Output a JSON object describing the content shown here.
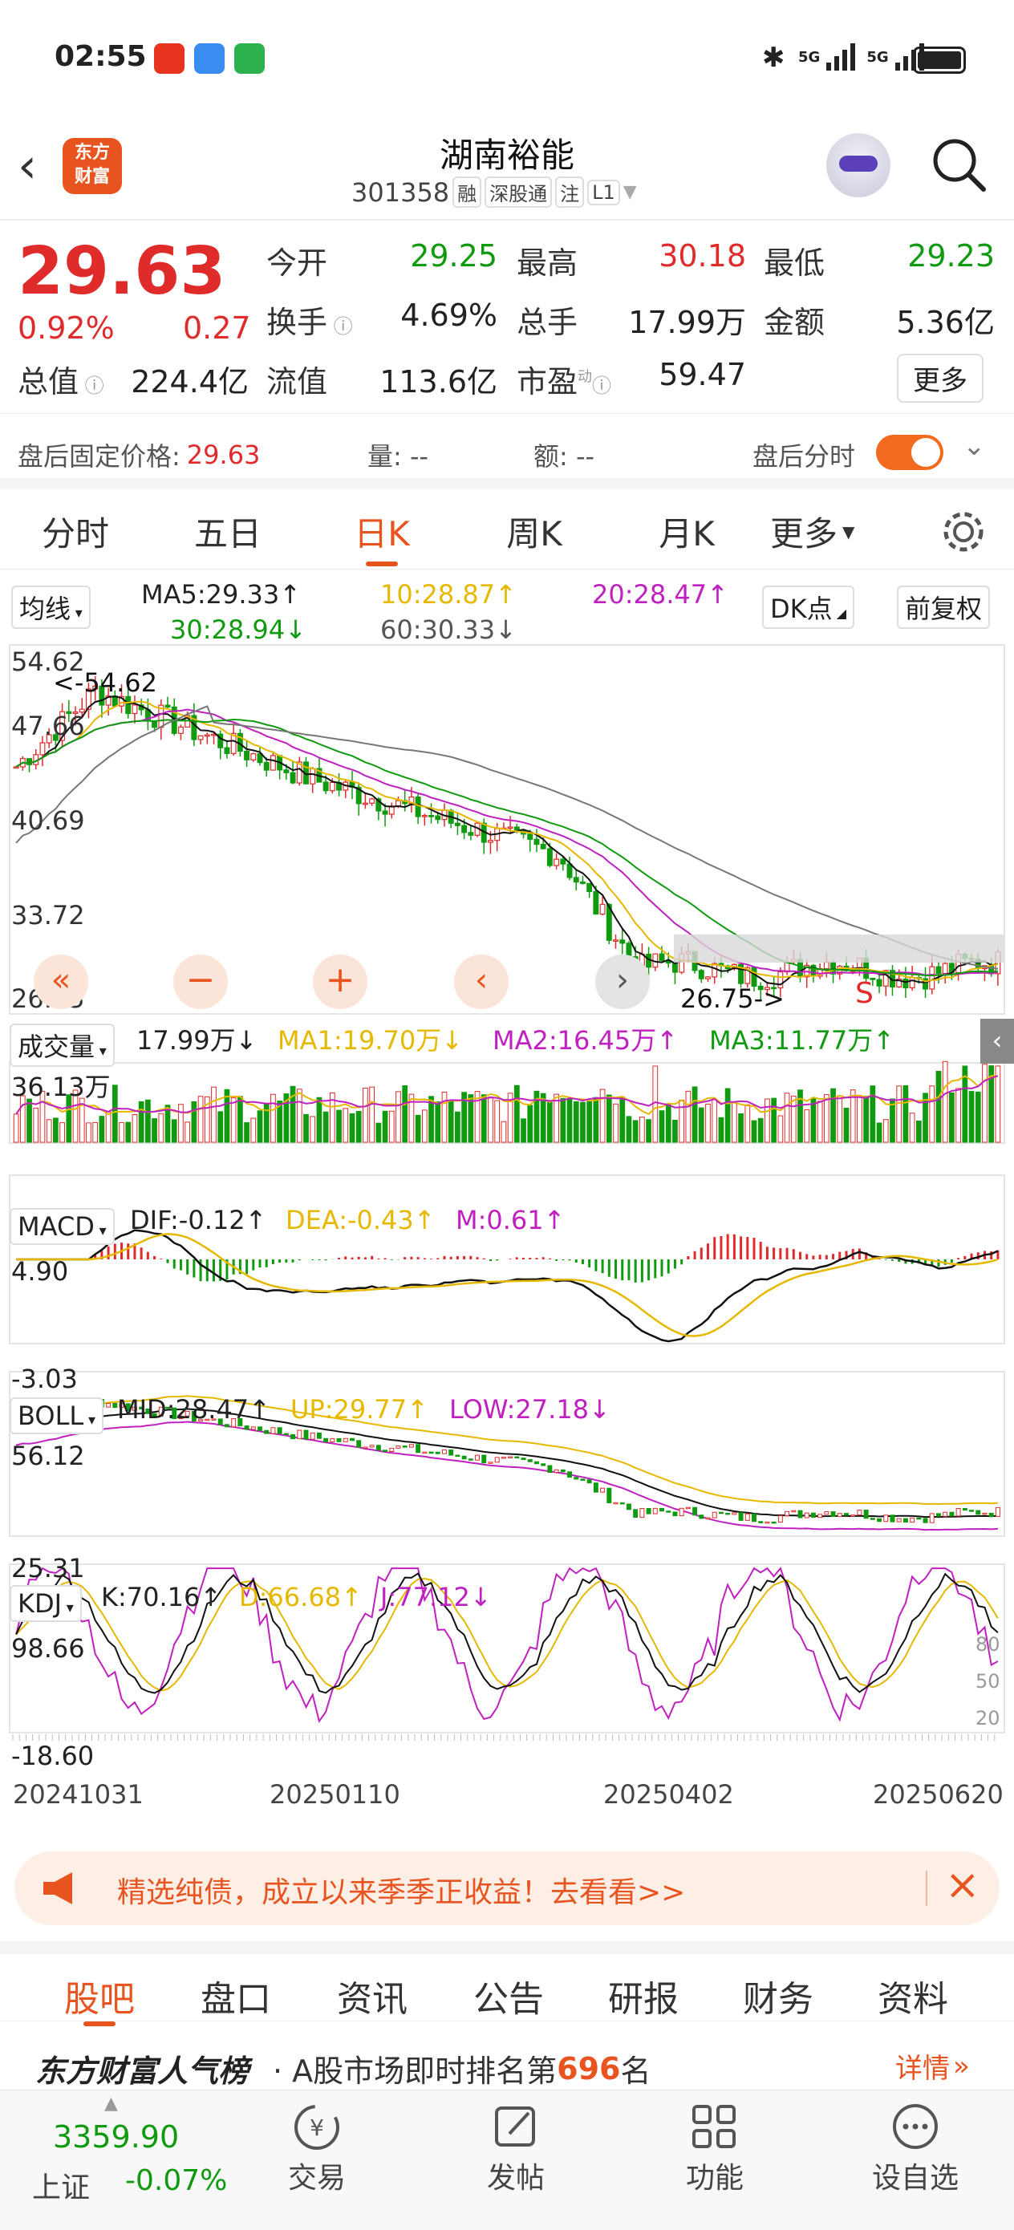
{
  "status": {
    "time": "02:55",
    "signal_labels": [
      "5G",
      "5G"
    ]
  },
  "header": {
    "title": "湖南裕能",
    "code": "301358",
    "tags": [
      "融",
      "深股通",
      "注",
      "L1"
    ],
    "logo_text_1": "东方",
    "logo_text_2": "财富"
  },
  "quote": {
    "price": "29.63",
    "change_pct": "0.92%",
    "change": "0.27",
    "rows": [
      [
        {
          "label": "今开",
          "value": "29.25",
          "color": "green"
        },
        {
          "label": "最高",
          "value": "30.18",
          "color": "red"
        },
        {
          "label": "最低",
          "value": "29.23",
          "color": "green"
        }
      ],
      [
        {
          "label": "换手",
          "value": "4.69%",
          "color": "black"
        },
        {
          "label": "总手",
          "value": "17.99万",
          "color": "black"
        },
        {
          "label": "金额",
          "value": "5.36亿",
          "color": "black"
        }
      ],
      [
        {
          "label": "总值",
          "value": "224.4亿",
          "color": "black"
        },
        {
          "label": "流值",
          "value": "113.6亿",
          "color": "black"
        },
        {
          "label": "市盈",
          "value": "59.47",
          "color": "black"
        }
      ]
    ],
    "pe_superscript": "动",
    "more_button": "更多"
  },
  "afterhours": {
    "fixed_price_label": "盘后固定价格:",
    "fixed_price": "29.63",
    "volume_label": "量: --",
    "amount_label": "额: --",
    "timeshare_label": "盘后分时",
    "toggle_on": true
  },
  "tabs": {
    "items": [
      "分时",
      "五日",
      "日K",
      "周K",
      "月K",
      "更多"
    ],
    "active_index": 2
  },
  "ma": {
    "selector": "均线",
    "ma5": "MA5:29.33↑",
    "ma10": "10:28.87↑",
    "ma20": "20:28.47↑",
    "ma30": "30:28.94↓",
    "ma60": "60:30.33↓",
    "dk_button": "DK点",
    "adjust_button": "前复权"
  },
  "kchart": {
    "y_labels": [
      "54.62",
      "47.66",
      "40.69",
      "33.72",
      "26.75"
    ],
    "high_marker": "<-54.62",
    "low_marker": "26.75->",
    "s_marker": "S"
  },
  "volume": {
    "selector": "成交量",
    "value": "17.99万↓",
    "ma1": "MA1:19.70万↓",
    "ma2": "MA2:16.45万↑",
    "ma3": "MA3:11.77万↑",
    "max_label": "36.13万"
  },
  "macd": {
    "selector": "MACD",
    "dif": "DIF:-0.12↑",
    "dea": "DEA:-0.43↑",
    "m": "M:0.61↑",
    "max_label": "4.90",
    "min_label": "-3.03"
  },
  "boll": {
    "selector": "BOLL",
    "mid": "MID:28.47↑",
    "up": "UP:29.77↑",
    "low": "LOW:27.18↓",
    "max_label": "56.12",
    "min_label": "25.31"
  },
  "kdj": {
    "selector": "KDJ",
    "k": "K:70.16↑",
    "d": "D:66.68↑",
    "j": "J:77.12↓",
    "max_label": "98.66",
    "min_label": "-18.60",
    "right_labels": [
      "80",
      "50",
      "20"
    ]
  },
  "dates": [
    "20241031",
    "20250110",
    "20250402",
    "20250620"
  ],
  "ad": {
    "text": "精选纯债，成立以来季季正收益！去看看>>"
  },
  "subtabs": {
    "items": [
      "股吧",
      "盘口",
      "资讯",
      "公告",
      "研报",
      "财务",
      "资料"
    ],
    "active_index": 0
  },
  "rank": {
    "title": "东方财富人气榜",
    "text_prefix": "· A股市场即时排名第",
    "rank": "696",
    "text_suffix": "名",
    "detail": "详情"
  },
  "bottomnav": {
    "index_value": "3359.90",
    "index_name": "上证",
    "index_change": "-0.07%",
    "items": [
      "交易",
      "发帖",
      "功能",
      "设自选"
    ]
  },
  "colors": {
    "accent": "#e8541f",
    "up": "#e02b2b",
    "down": "#109a10",
    "ma10": "#e6b800",
    "ma20": "#c020c0",
    "ma30": "#109a10"
  }
}
